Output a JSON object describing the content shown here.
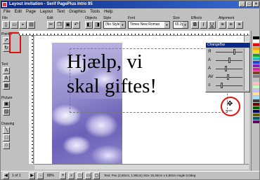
{
  "window": {
    "title": "Layout invitation - Serif PagePlus Intro 95",
    "controls": [
      "_",
      "□",
      "×"
    ]
  },
  "menu": [
    "File",
    "Edit",
    "Page",
    "Layout",
    "Text",
    "Graphics",
    "Tools",
    "Help"
  ],
  "toolbar": {
    "group_labels": {
      "file": "File",
      "edit": "Edit",
      "objects": "Objects",
      "style": "Style",
      "font": "Font",
      "size": "Size",
      "effects": "Effects",
      "alignment": "Alignment"
    },
    "style_value": "(No Style)",
    "font_value": "Times New Roman",
    "size_value": "65.2p",
    "bold": "B",
    "italic": "I",
    "underline": "U"
  },
  "left_panel": {
    "labels": {
      "pointer": "Pointer",
      "text": "Text",
      "picture": "Picture",
      "drawing": "Drawing"
    }
  },
  "canvas": {
    "headline_line1": "Hjælp, vi",
    "headline_line2": "skal giftes!"
  },
  "change_bar": {
    "title": "ChangeBar",
    "rows": [
      {
        "icon": "Я",
        "value": 0.7
      },
      {
        "icon": "A",
        "value": 0.5
      },
      {
        "icon": "A",
        "value": 0.35
      },
      {
        "icon": "AV",
        "value": 0.45
      },
      {
        "icon": "≡",
        "value": 0.2
      }
    ]
  },
  "cursor": {
    "label": "move"
  },
  "status": {
    "page": "1 of 1",
    "zoom": "89%",
    "info": "Text: Pos (2,80cm, 1,90cm)  Size 15,40cm x 5,50cm  Angle 0,0deg"
  },
  "colors": {
    "accent_red": "#e01010",
    "title_blue": "#0a2a8a"
  }
}
